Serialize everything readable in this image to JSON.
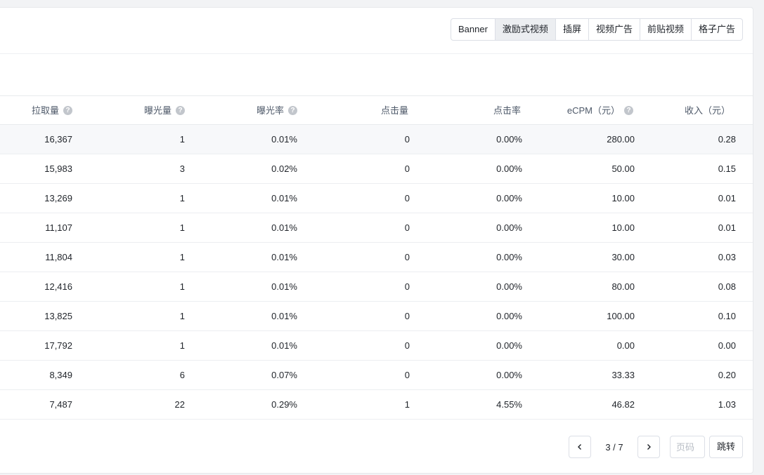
{
  "ad_types": [
    "Banner",
    "激励式视频",
    "插屏",
    "视频广告",
    "前贴视频",
    "格子广告"
  ],
  "active_ad_type": "激励式视频",
  "columns": [
    "拉取量",
    "曝光量",
    "曝光率",
    "点击量",
    "点击率",
    "eCPM（元）",
    "收入（元）"
  ],
  "help_icon_glyph": "?",
  "rows": [
    [
      "16,367",
      "1",
      "0.01%",
      "0",
      "0.00%",
      "280.00",
      "0.28"
    ],
    [
      "15,983",
      "3",
      "0.02%",
      "0",
      "0.00%",
      "50.00",
      "0.15"
    ],
    [
      "13,269",
      "1",
      "0.01%",
      "0",
      "0.00%",
      "10.00",
      "0.01"
    ],
    [
      "11,107",
      "1",
      "0.01%",
      "0",
      "0.00%",
      "10.00",
      "0.01"
    ],
    [
      "11,804",
      "1",
      "0.01%",
      "0",
      "0.00%",
      "30.00",
      "0.03"
    ],
    [
      "12,416",
      "1",
      "0.01%",
      "0",
      "0.00%",
      "80.00",
      "0.08"
    ],
    [
      "13,825",
      "1",
      "0.01%",
      "0",
      "0.00%",
      "100.00",
      "0.10"
    ],
    [
      "17,792",
      "1",
      "0.01%",
      "0",
      "0.00%",
      "0.00",
      "0.00"
    ],
    [
      "8,349",
      "6",
      "0.07%",
      "0",
      "0.00%",
      "33.33",
      "0.20"
    ],
    [
      "7,487",
      "22",
      "0.29%",
      "1",
      "4.55%",
      "46.82",
      "1.03"
    ]
  ],
  "pagination": {
    "info": "3 / 7",
    "page_input_placeholder": "页码",
    "jump_label": "跳转"
  }
}
